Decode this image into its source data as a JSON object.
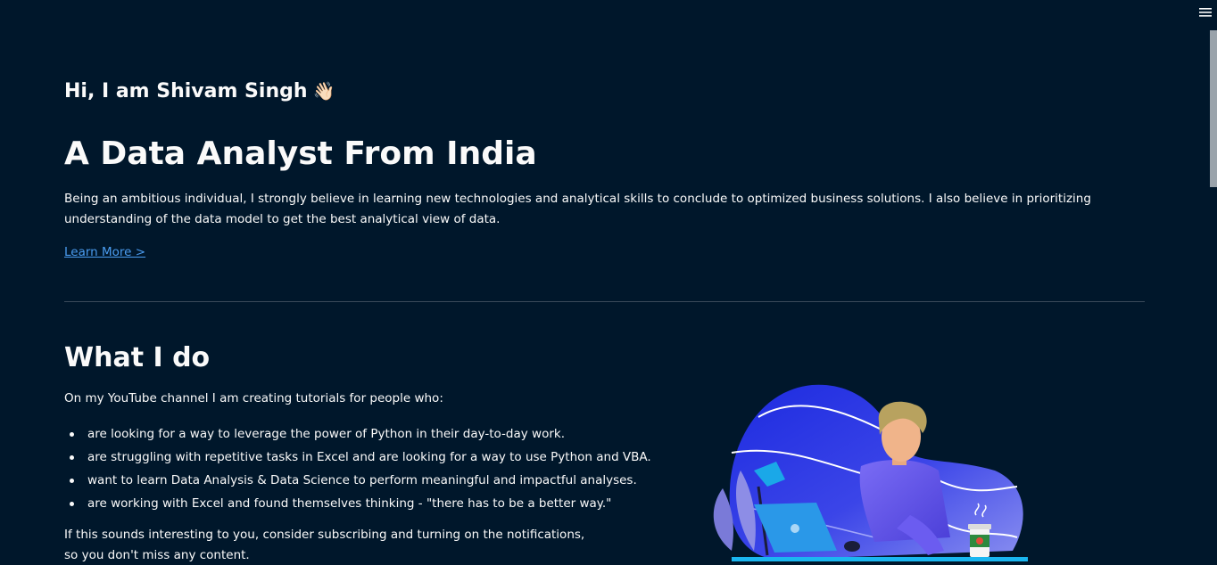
{
  "header": {
    "menu_icon": "hamburger-menu-icon"
  },
  "hero": {
    "greeting": "Hi, I am Shivam Singh",
    "greeting_emoji": "👋🏻",
    "headline": "A Data Analyst From India",
    "intro": "Being an ambitious individual, I strongly believe in learning new technologies and analytical skills to conclude to optimized business solutions. I also believe in prioritizing understanding of the data model to get the best analytical view of data.",
    "learn_more": "Learn More >"
  },
  "what_i_do": {
    "title": "What I do",
    "intro": "On my YouTube channel I am creating tutorials for people who:",
    "items": [
      "are looking for a way to leverage the power of Python in their day-to-day work.",
      "are struggling with repetitive tasks in Excel and are looking for a way to use Python and VBA.",
      "want to learn Data Analysis & Data Science to perform meaningful and impactful analyses.",
      "are working with Excel and found themselves thinking - \"there has to be a better way.\""
    ],
    "outro": "If this sounds interesting to you, consider subscribing and turning on the notifications, so you don't miss any content."
  },
  "colors": {
    "background": "#00172b",
    "text": "#fafafa",
    "link": "#4a9cf0",
    "divider": "#3a4a5a",
    "illustration_blob": "#2f3de0",
    "illustration_shirt": "#6b5cf0"
  }
}
